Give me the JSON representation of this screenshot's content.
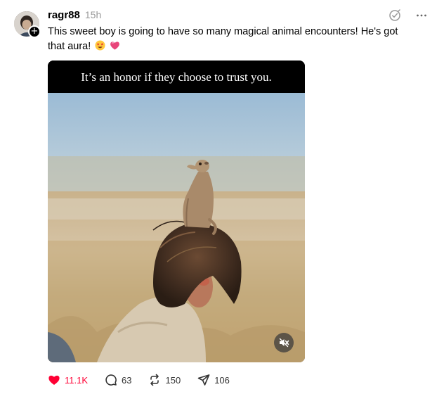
{
  "post": {
    "username": "ragr88",
    "timestamp": "15h",
    "text": "This sweet boy is going to have so many magical animal encounters! He's got that aura!",
    "follow_symbol": "+",
    "emojis": [
      "star-struck-face-emoji",
      "pink-heart-emoji"
    ],
    "media": {
      "caption": "It’s an honor if they choose to trust you.",
      "mute_icon": "speaker-muted-icon"
    }
  },
  "actions": {
    "likes": "11.1K",
    "comments": "63",
    "reposts": "150",
    "shares": "106"
  },
  "colors": {
    "like_red": "#ff0034",
    "muted_text": "#999999"
  }
}
